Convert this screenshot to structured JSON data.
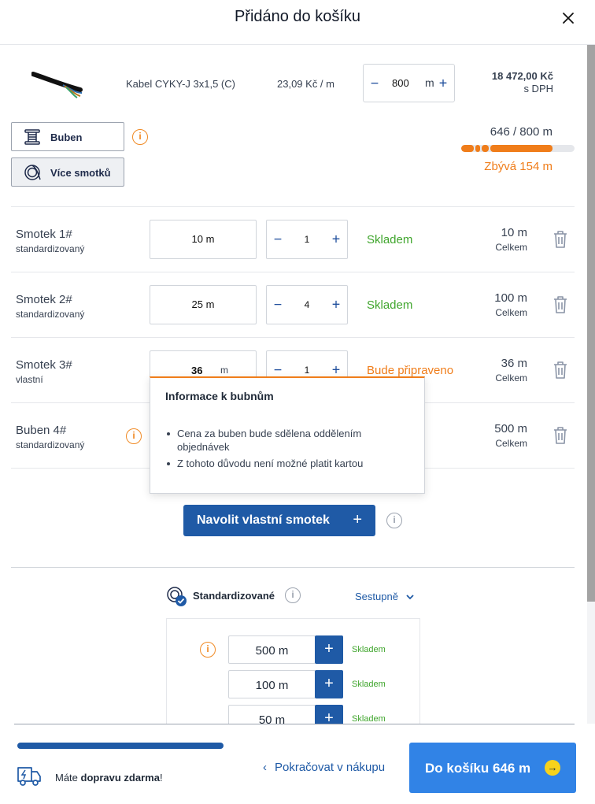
{
  "header": {
    "title": "Přidáno do košíku"
  },
  "product": {
    "name": "Kabel CYKY-J 3x1,5 (C)",
    "unit_price": "23,09 Kč / m",
    "quantity": "800",
    "quantity_unit": "m",
    "total": "18 472,00 Kč",
    "vat_note": "s DPH"
  },
  "packaging": {
    "drum_label": "Buben",
    "coils_label": "Více smotků",
    "progress_label": "646 / 800 m",
    "progress_fraction": 0.8075,
    "remaining_label": "Zbývá 154 m"
  },
  "rows": [
    {
      "title": "Smotek 1#",
      "subtitle": "standardizovaný",
      "length": "10 m",
      "count": "1",
      "status": "Skladem",
      "total": "10 m",
      "total_label": "Celkem"
    },
    {
      "title": "Smotek 2#",
      "subtitle": "standardizovaný",
      "length": "25 m",
      "count": "4",
      "status": "Skladem",
      "total": "100 m",
      "total_label": "Celkem"
    },
    {
      "title": "Smotek 3#",
      "subtitle": "vlastní",
      "length": "36",
      "length_unit": "m",
      "count": "1",
      "status": "Bude připraveno",
      "total": "36 m",
      "total_label": "Celkem"
    },
    {
      "title": "Buben 4#",
      "subtitle": "standardizovaný",
      "total": "500 m",
      "total_label": "Celkem"
    }
  ],
  "tooltip": {
    "title": "Informace k bubnům",
    "items": [
      "Cena za buben bude sdělena oddělením objednávek",
      "Z tohoto důvodu není možné platit kartou"
    ]
  },
  "custom_coil_button": "Navolit vlastní smotek",
  "standard": {
    "label": "Standardizované",
    "sort": "Sestupně",
    "items": [
      {
        "length": "500 m",
        "status": "Skladem"
      },
      {
        "length": "100 m",
        "status": "Skladem"
      },
      {
        "length": "50 m",
        "status": "Skladem"
      }
    ]
  },
  "footer": {
    "shipping_prefix": "Máte ",
    "shipping_bold": "dopravu zdarma",
    "shipping_suffix": "!",
    "continue_label": "Pokračovat v nákupu",
    "cart_label": "Do košíku 646 m"
  },
  "colors": {
    "accent_blue": "#1f5aa6",
    "cart_blue": "#3183e6",
    "orange": "#f07d1a",
    "green": "#3fa52c"
  },
  "icons": {
    "close": "close-icon",
    "drum": "drum-icon",
    "coil": "coil-icon",
    "info": "info-icon",
    "trash": "trash-icon",
    "truck": "truck-icon",
    "arrow": "arrow-right-icon"
  }
}
